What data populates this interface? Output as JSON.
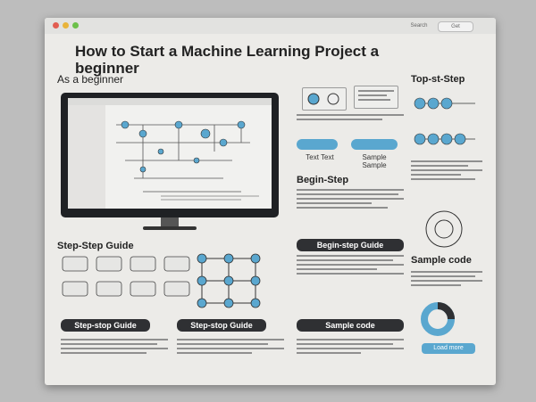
{
  "window": {
    "title": "How to Start a Machine Learning Project a beginner",
    "subtitle": "As a beginner",
    "topbar_search": "Search",
    "topbar_button": "Get",
    "right_heading": "Top-st-Step"
  },
  "labels": {
    "text_left": "Text Text",
    "text_right": "Sample Sample",
    "begin_step": "Begin-Step",
    "step_guide_left": "Step-Step Guide",
    "begin_step_guide": "Begin-step Guide",
    "sample_code_right": "Sample code",
    "step_stop_left": "Step-stop Guide",
    "step_stop_mid": "Step-stop Guide",
    "sample_code_mid": "Sample code",
    "cta": "Load more"
  },
  "colors": {
    "accent": "#5aa7cf",
    "dark": "#2f3033",
    "panel": "#ecebe8"
  }
}
